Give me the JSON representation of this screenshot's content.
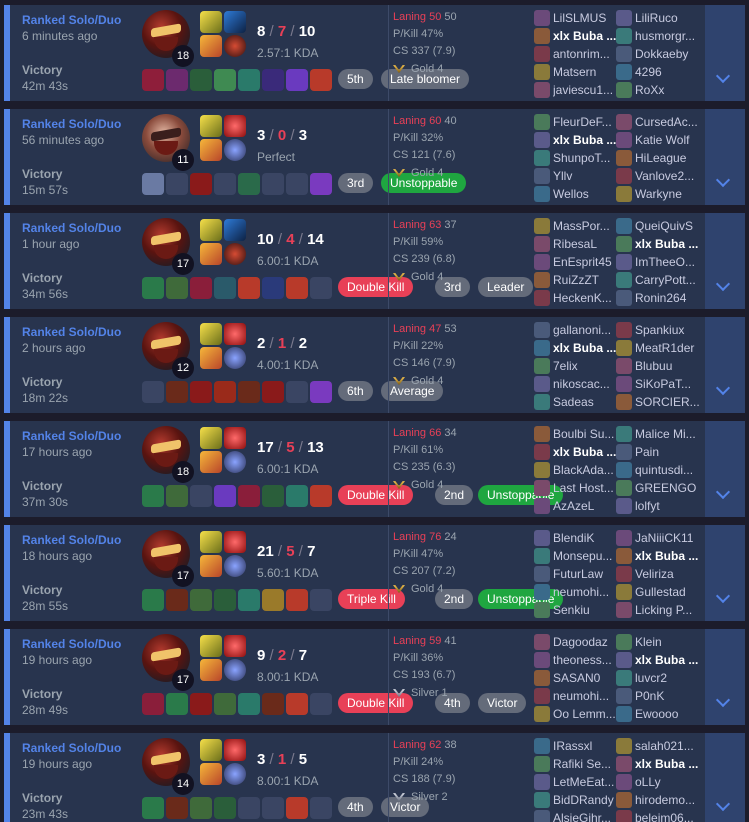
{
  "matches": [
    {
      "queue": "Ranked Solo/Duo",
      "time_ago": "6 minutes ago",
      "result": "Victory",
      "duration": "42m 43s",
      "level": "18",
      "kills": "8",
      "deaths": "7",
      "assists": "10",
      "kda": "2.57:1 KDA",
      "laning_label": "Laning 50",
      "laning_opp": "50",
      "p_kill": "P/Kill 47%",
      "cs": "CS 337 (7.9)",
      "rank": "Gold 4",
      "rank_tier": "gold",
      "champ_style": "main",
      "spells": [
        "sp-a",
        "sp-b",
        "sp-d",
        "rune1"
      ],
      "item_colors": [
        "#8e1e3a",
        "#6c2a6e",
        "#2a5e3a",
        "#3f8a52",
        "#2a7a6a",
        "#3a2a7a",
        "#6a3abf",
        "#b83a2a"
      ],
      "badges": [
        {
          "text": "5th",
          "color": "gray"
        },
        {
          "text": "Late bloomer",
          "color": "gray"
        }
      ],
      "team1": [
        "LilSLMUS",
        "xlx Buba ...",
        "antonrim...",
        "Matsern",
        "javiescu1..."
      ],
      "team2": [
        "LiliRuco",
        "husmorgr...",
        "Dokkaeby",
        "4296",
        "RoXx"
      ]
    },
    {
      "queue": "Ranked Solo/Duo",
      "time_ago": "56 minutes ago",
      "result": "Victory",
      "duration": "15m 57s",
      "level": "11",
      "kills": "3",
      "deaths": "0",
      "assists": "3",
      "kda": "Perfect",
      "laning_label": "Laning 60",
      "laning_opp": "40",
      "p_kill": "P/Kill 32%",
      "cs": "CS 121 (7.6)",
      "rank": "Gold 4",
      "rank_tier": "gold",
      "champ_style": "alt",
      "spells": [
        "sp-a",
        "sp-c",
        "sp-d",
        "rune2"
      ],
      "item_colors": [
        "#6a7aa3",
        "#3a4563",
        "#8a1a1a",
        "#3a4563",
        "#2a6a4a",
        "#3a4563",
        "#3a4563",
        "#7a3abf"
      ],
      "badges": [
        {
          "text": "3rd",
          "color": "gray"
        },
        {
          "text": "Unstoppable",
          "color": "green2"
        }
      ],
      "team1": [
        "FleurDeF...",
        "xlx Buba ...",
        "ShunpoT...",
        "Yllv",
        "Wellos"
      ],
      "team2": [
        "CursedAc...",
        "Katie Wolf",
        "HiLeague",
        "Vanlove2...",
        "Warkyne"
      ]
    },
    {
      "queue": "Ranked Solo/Duo",
      "time_ago": "1 hour ago",
      "result": "Victory",
      "duration": "34m 56s",
      "level": "17",
      "kills": "10",
      "deaths": "4",
      "assists": "14",
      "kda": "6.00:1 KDA",
      "laning_label": "Laning 63",
      "laning_opp": "37",
      "p_kill": "P/Kill 59%",
      "cs": "CS 239 (6.8)",
      "rank": "Gold 4",
      "rank_tier": "gold",
      "champ_style": "main",
      "spells": [
        "sp-a",
        "sp-b",
        "sp-d",
        "rune1"
      ],
      "item_colors": [
        "#2a7a4a",
        "#3f6a3a",
        "#8a1e3a",
        "#2a5a6a",
        "#b83a2a",
        "#2a3a7a",
        "#b83a2a",
        "#3a4563"
      ],
      "badges": [
        {
          "text": "Double Kill",
          "color": "red"
        },
        {
          "text": "3rd",
          "color": "gray"
        },
        {
          "text": "Leader",
          "color": "gray"
        }
      ],
      "team1": [
        "MassPor...",
        "RibesaL",
        "EnEsprit45",
        "RuiZzZT",
        "HeckenK..."
      ],
      "team2": [
        "QueiQuivS",
        "xlx Buba ...",
        "ImTheeO...",
        "CarryPott...",
        "Ronin264"
      ]
    },
    {
      "queue": "Ranked Solo/Duo",
      "time_ago": "2 hours ago",
      "result": "Victory",
      "duration": "18m 22s",
      "level": "12",
      "kills": "2",
      "deaths": "1",
      "assists": "2",
      "kda": "4.00:1 KDA",
      "laning_label": "Laning 47",
      "laning_opp": "53",
      "p_kill": "P/Kill 22%",
      "cs": "CS 146 (7.9)",
      "rank": "Gold 4",
      "rank_tier": "gold",
      "champ_style": "main",
      "spells": [
        "sp-a",
        "sp-c",
        "sp-d",
        "rune2"
      ],
      "item_colors": [
        "#3a4563",
        "#6a2a1a",
        "#8a1a1a",
        "#9a2a1a",
        "#6a2a1a",
        "#8a1a1a",
        "#3a4563",
        "#7a3abf"
      ],
      "badges": [
        {
          "text": "6th",
          "color": "gray"
        },
        {
          "text": "Average",
          "color": "gray"
        }
      ],
      "team1": [
        "gallanoni...",
        "xlx Buba ...",
        "7elix",
        "nikoscac...",
        "Sadeas"
      ],
      "team2": [
        "Spankiux",
        "MeatR1der",
        "Blubuu",
        "SiKoPaT...",
        "SORCIER..."
      ]
    },
    {
      "queue": "Ranked Solo/Duo",
      "time_ago": "17 hours ago",
      "result": "Victory",
      "duration": "37m 30s",
      "level": "18",
      "kills": "17",
      "deaths": "5",
      "assists": "13",
      "kda": "6.00:1 KDA",
      "laning_label": "Laning 66",
      "laning_opp": "34",
      "p_kill": "P/Kill 61%",
      "cs": "CS 235 (6.3)",
      "rank": "Gold 4",
      "rank_tier": "gold",
      "champ_style": "main",
      "spells": [
        "sp-a",
        "sp-c",
        "sp-d",
        "rune2"
      ],
      "item_colors": [
        "#2a7a4a",
        "#3f6a3a",
        "#3a4563",
        "#6a3abf",
        "#8a1e3a",
        "#2a5e3a",
        "#2a7a6a",
        "#b83a2a"
      ],
      "badges": [
        {
          "text": "Double Kill",
          "color": "red"
        },
        {
          "text": "2nd",
          "color": "gray"
        },
        {
          "text": "Unstoppable",
          "color": "green2"
        }
      ],
      "team1": [
        "Boulbi Su...",
        "xlx Buba ...",
        "BlackAda...",
        "Last Host...",
        "AzAzeL"
      ],
      "team2": [
        "Malice Mi...",
        "Pain",
        "quintusdi...",
        "GREENGO",
        "lolfyt"
      ]
    },
    {
      "queue": "Ranked Solo/Duo",
      "time_ago": "18 hours ago",
      "result": "Victory",
      "duration": "28m 55s",
      "level": "17",
      "kills": "21",
      "deaths": "5",
      "assists": "7",
      "kda": "5.60:1 KDA",
      "laning_label": "Laning 76",
      "laning_opp": "24",
      "p_kill": "P/Kill 47%",
      "cs": "CS 207 (7.2)",
      "rank": "Gold 4",
      "rank_tier": "gold",
      "champ_style": "main",
      "spells": [
        "sp-a",
        "sp-c",
        "sp-d",
        "rune2"
      ],
      "item_colors": [
        "#2a7a4a",
        "#6a2a1a",
        "#3f6a3a",
        "#2a5e3a",
        "#2a7a6a",
        "#9a7a2a",
        "#b83a2a",
        "#3a4563"
      ],
      "badges": [
        {
          "text": "Triple Kill",
          "color": "red"
        },
        {
          "text": "2nd",
          "color": "gray"
        },
        {
          "text": "Unstoppable",
          "color": "green2"
        }
      ],
      "team1": [
        "BlendiK",
        "Monsepu...",
        "FuturLaw",
        "neumohi...",
        "Senkiu"
      ],
      "team2": [
        "JaNiiiCK11",
        "xlx Buba ...",
        "Veliriza",
        "Gullestad",
        "Licking P..."
      ]
    },
    {
      "queue": "Ranked Solo/Duo",
      "time_ago": "19 hours ago",
      "result": "Victory",
      "duration": "28m 49s",
      "level": "17",
      "kills": "9",
      "deaths": "2",
      "assists": "7",
      "kda": "8.00:1 KDA",
      "laning_label": "Laning 59",
      "laning_opp": "41",
      "p_kill": "P/Kill 36%",
      "cs": "CS 193 (6.7)",
      "rank": "Silver 1",
      "rank_tier": "silver",
      "champ_style": "main",
      "spells": [
        "sp-a",
        "sp-c",
        "sp-d",
        "rune2"
      ],
      "item_colors": [
        "#8a1e3a",
        "#2a7a4a",
        "#8a1a1a",
        "#3f6a3a",
        "#2a7a6a",
        "#6a2a1a",
        "#b83a2a",
        "#3a4563"
      ],
      "badges": [
        {
          "text": "Double Kill",
          "color": "red"
        },
        {
          "text": "4th",
          "color": "gray"
        },
        {
          "text": "Victor",
          "color": "gray"
        }
      ],
      "team1": [
        "Dagoodaz",
        "theoness...",
        "SASAN0",
        "neumohi...",
        "Oo Lemm..."
      ],
      "team2": [
        "Klein",
        "xlx Buba ...",
        "luvcr2",
        "P0nK",
        "Ewoooo"
      ]
    },
    {
      "queue": "Ranked Solo/Duo",
      "time_ago": "19 hours ago",
      "result": "Victory",
      "duration": "23m 43s",
      "level": "14",
      "kills": "3",
      "deaths": "1",
      "assists": "5",
      "kda": "8.00:1 KDA",
      "laning_label": "Laning 62",
      "laning_opp": "38",
      "p_kill": "P/Kill 24%",
      "cs": "CS 188 (7.9)",
      "rank": "Silver 2",
      "rank_tier": "silver",
      "champ_style": "main",
      "spells": [
        "sp-a",
        "sp-c",
        "sp-d",
        "rune2"
      ],
      "item_colors": [
        "#2a7a4a",
        "#6a2a1a",
        "#3f6a3a",
        "#2a5e3a",
        "#3a4563",
        "#3a4563",
        "#b83a2a",
        "#3a4563"
      ],
      "badges": [
        {
          "text": "4th",
          "color": "gray"
        },
        {
          "text": "Victor",
          "color": "gray"
        }
      ],
      "team1": [
        "IRassxl",
        "Rafiki Se...",
        "LetMeEat...",
        "BidDRandy",
        "AlsieGihr..."
      ],
      "team2": [
        "salah021...",
        "xlx Buba ...",
        "oLLy",
        "hirodemo...",
        "beleim06..."
      ]
    }
  ],
  "me_name": "xlx Buba ...",
  "colors": {
    "accent": "#5383e8",
    "loss": "#e84057",
    "card": "#28344e",
    "bg": "#1c1c2b"
  }
}
